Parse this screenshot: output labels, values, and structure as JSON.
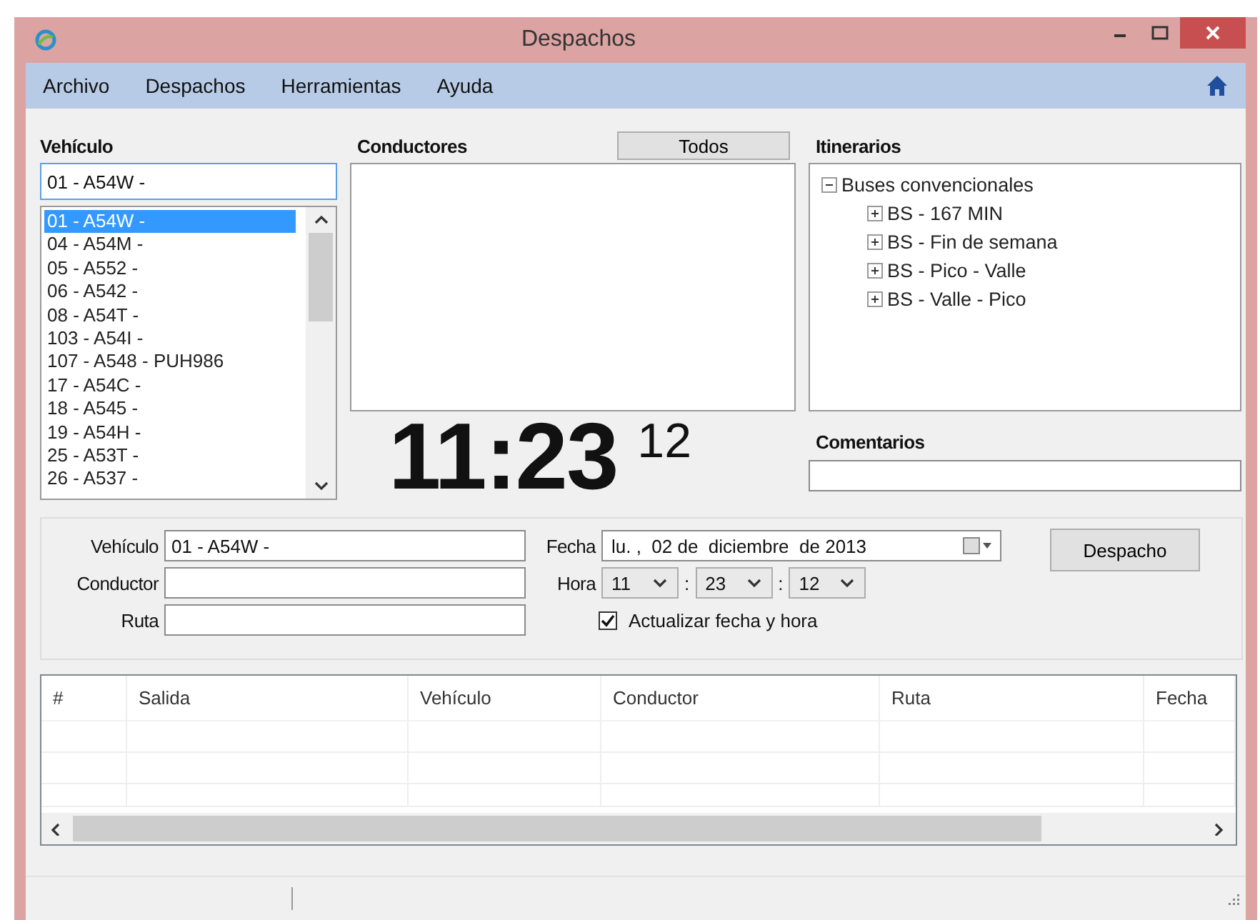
{
  "window": {
    "title": "Despachos"
  },
  "menu": [
    "Archivo",
    "Despachos",
    "Herramientas",
    "Ayuda"
  ],
  "vehicle_panel": {
    "label": "Vehículo",
    "combo_value": "01 - A54W -",
    "items": [
      {
        "text": "01 - A54W -",
        "selected": true
      },
      {
        "text": "04 - A54M -",
        "selected": false
      },
      {
        "text": "05 - A552 -",
        "selected": false
      },
      {
        "text": "06 - A542 -",
        "selected": false
      },
      {
        "text": "08 - A54T -",
        "selected": false
      },
      {
        "text": "103 - A54I -",
        "selected": false
      },
      {
        "text": "107 - A548 - PUH986",
        "selected": false
      },
      {
        "text": "17 - A54C -",
        "selected": false
      },
      {
        "text": "18 - A545 -",
        "selected": false
      },
      {
        "text": "19 - A54H -",
        "selected": false
      },
      {
        "text": "25 - A53T -",
        "selected": false
      },
      {
        "text": "26 - A537 -",
        "selected": false
      }
    ]
  },
  "drivers_panel": {
    "label": "Conductores",
    "button": "Todos"
  },
  "clock": {
    "time": "11:23",
    "seconds": "12"
  },
  "itineraries_panel": {
    "label": "Itinerarios",
    "tree": [
      {
        "label": "Buses convencionales",
        "expanded": true,
        "children": [
          {
            "label": "BS - 167 MIN",
            "expanded": false
          },
          {
            "label": "BS - Fin de semana",
            "expanded": false
          },
          {
            "label": "BS - Pico - Valle",
            "expanded": false
          },
          {
            "label": "BS - Valle - Pico",
            "expanded": false
          }
        ]
      }
    ]
  },
  "comments": {
    "label": "Comentarios"
  },
  "dispatch_form": {
    "fields": [
      {
        "label": "Vehículo",
        "value": "01 - A54W -"
      },
      {
        "label": "Conductor"
      },
      {
        "label": "Ruta"
      }
    ],
    "date": {
      "label": "Fecha",
      "value": "lu. ,  02 de  diciembre  de 2013"
    },
    "time": {
      "label": "Hora",
      "parts": [
        "11",
        "23",
        "12"
      ],
      "separators": [
        ":",
        ":"
      ]
    },
    "auto_update": {
      "label": "Actualizar fecha y hora",
      "checked": true
    },
    "button": "Despacho"
  },
  "table": {
    "columns": [
      "#",
      "Salida",
      "Vehículo",
      "Conductor",
      "Ruta",
      "Fecha"
    ]
  }
}
